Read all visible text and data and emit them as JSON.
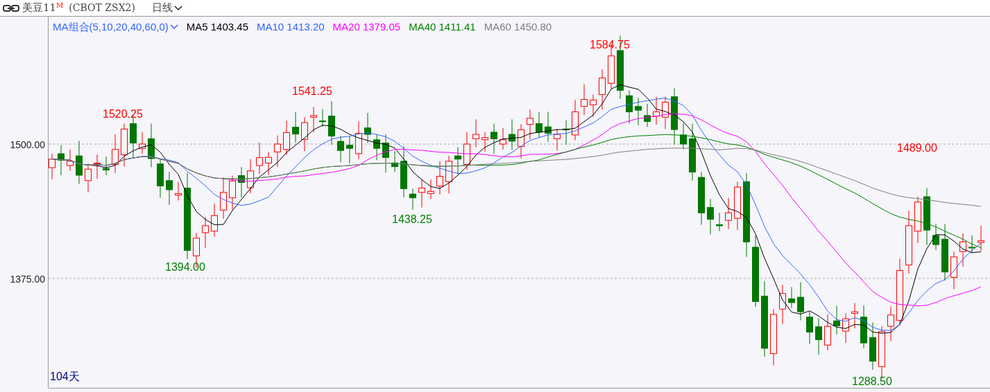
{
  "header": {
    "title": "美豆11",
    "superscript": "M",
    "code": "(CBOT ZSX2)",
    "period": "日线"
  },
  "legend": {
    "selector": "MA组合(5,10,20,40,60,0)",
    "items": [
      {
        "label": "MA5 1403.45",
        "color": "#000000"
      },
      {
        "label": "MA10 1413.20",
        "color": "#3366ff"
      },
      {
        "label": "MA20 1379.05",
        "color": "#ff00ff"
      },
      {
        "label": "MA40 1411.41",
        "color": "#007f00"
      },
      {
        "label": "MA60 1450.80",
        "color": "#808080"
      }
    ]
  },
  "price_axis": [
    "1500.00",
    "1375.00"
  ],
  "extremes": [
    {
      "text": "1520.25",
      "kind": "high"
    },
    {
      "text": "1541.25",
      "kind": "high"
    },
    {
      "text": "1584.75",
      "kind": "high"
    },
    {
      "text": "1489.00",
      "kind": "high"
    },
    {
      "text": "1394.00",
      "kind": "low"
    },
    {
      "text": "1438.25",
      "kind": "low"
    },
    {
      "text": "1288.50",
      "kind": "low"
    }
  ],
  "footer": "104天"
}
